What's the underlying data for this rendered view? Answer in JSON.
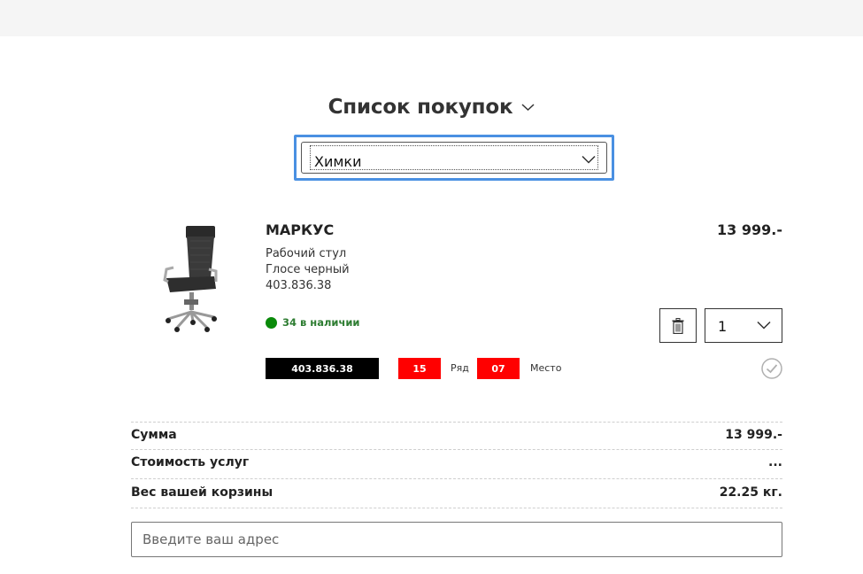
{
  "header": {
    "title": "Список покупок"
  },
  "store_select": {
    "value": "Химки"
  },
  "product": {
    "name": "МАРКУС",
    "type": "Рабочий стул",
    "color": "Глосе черный",
    "article": "403.836.38",
    "price": "13 999.-",
    "stock": "34 в наличии",
    "quantity": "1",
    "location": {
      "article": "403.836.38",
      "row_value": "15",
      "row_label": "Ряд",
      "place_value": "07",
      "place_label": "Место"
    }
  },
  "summary": [
    {
      "label": "Сумма",
      "value": "13 999.-"
    },
    {
      "label": "Стоимость услуг",
      "value": "..."
    },
    {
      "label": "Вес вашей корзины",
      "value": "22.25 кг."
    }
  ],
  "address": {
    "placeholder": "Введите ваш адрес"
  },
  "colors": {
    "focus": "#4a90e2",
    "stock": "#0a8a0a",
    "tag_red": "#ff0000",
    "tag_black": "#000000"
  },
  "icons": [
    "chevron-down-icon",
    "trash-icon",
    "check-circle-icon",
    "stock-dot-icon"
  ]
}
